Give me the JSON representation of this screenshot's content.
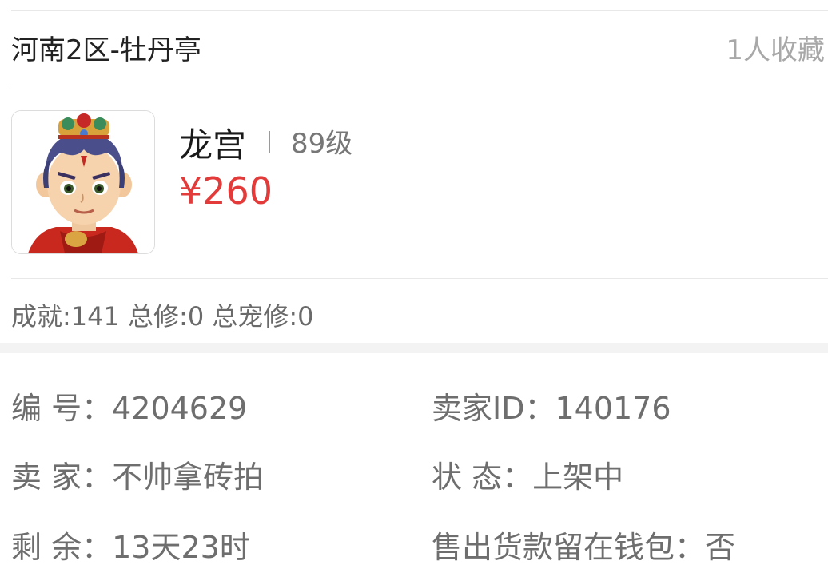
{
  "header": {
    "server": "河南2区-牡丹亭",
    "favorites": "1人收藏"
  },
  "role": {
    "avatar_icon": "character-portrait-icon",
    "name": "龙宫",
    "level": "89级",
    "price": "¥260",
    "price_color": "#e33a3a"
  },
  "stats": {
    "text": "成就:141 总修:0 总宠修:0"
  },
  "info": {
    "serial_label": "编  号：",
    "serial_value": "4204629",
    "seller_id_label": "卖家ID：",
    "seller_id_value": "140176",
    "seller_label": "卖  家：",
    "seller_value": "不帅拿砖拍",
    "status_label": "状  态：",
    "status_value": "上架中",
    "remaining_label": "剩  余：",
    "remaining_value": "13天23时",
    "wallet_label": "售出货款留在钱包：",
    "wallet_value": "否"
  }
}
